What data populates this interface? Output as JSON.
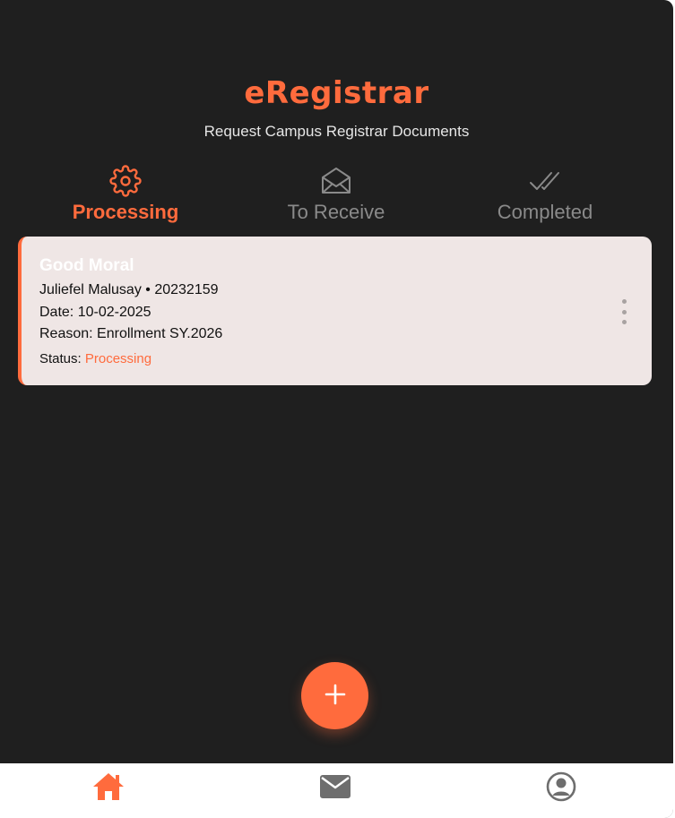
{
  "header": {
    "title": "eRegistrar",
    "subtitle": "Request Campus Registrar Documents"
  },
  "tabs": [
    {
      "label": "Processing",
      "icon": "gear-icon",
      "active": true
    },
    {
      "label": "To Receive",
      "icon": "open-envelope-icon",
      "active": false
    },
    {
      "label": "Completed",
      "icon": "double-check-icon",
      "active": false
    }
  ],
  "requests": [
    {
      "document": "Good Moral",
      "student_line": "Juliefel Malusay • 20232159",
      "date_line": "Date: 10-02-2025",
      "reason_line": "Reason: Enrollment SY.2026",
      "status_label": "Status:",
      "status_value": "Processing"
    }
  ],
  "fab": {
    "icon": "plus-icon"
  },
  "bottom_nav": [
    {
      "icon": "home-icon",
      "active": true
    },
    {
      "icon": "mail-icon",
      "active": false
    },
    {
      "icon": "profile-icon",
      "active": false
    }
  ],
  "colors": {
    "accent": "#ff6b3d",
    "background": "#1f1f1f",
    "card": "#efe6e5",
    "inactive": "#8a8a8a"
  }
}
